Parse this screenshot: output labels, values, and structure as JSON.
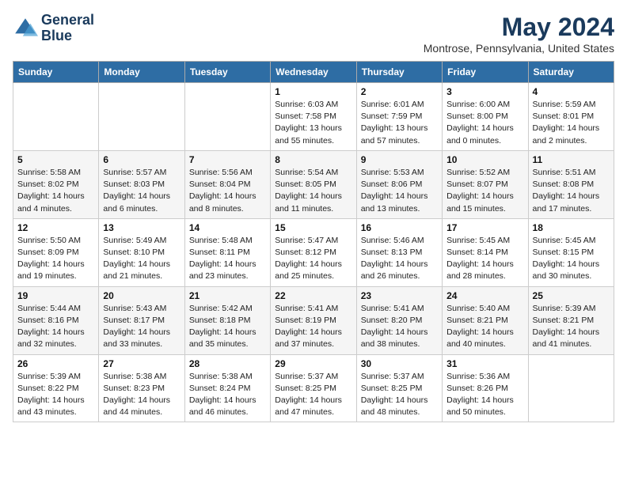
{
  "logo": {
    "line1": "General",
    "line2": "Blue"
  },
  "title": "May 2024",
  "location": "Montrose, Pennsylvania, United States",
  "days_header": [
    "Sunday",
    "Monday",
    "Tuesday",
    "Wednesday",
    "Thursday",
    "Friday",
    "Saturday"
  ],
  "weeks": [
    [
      {
        "day": "",
        "info": ""
      },
      {
        "day": "",
        "info": ""
      },
      {
        "day": "",
        "info": ""
      },
      {
        "day": "1",
        "info": "Sunrise: 6:03 AM\nSunset: 7:58 PM\nDaylight: 13 hours\nand 55 minutes."
      },
      {
        "day": "2",
        "info": "Sunrise: 6:01 AM\nSunset: 7:59 PM\nDaylight: 13 hours\nand 57 minutes."
      },
      {
        "day": "3",
        "info": "Sunrise: 6:00 AM\nSunset: 8:00 PM\nDaylight: 14 hours\nand 0 minutes."
      },
      {
        "day": "4",
        "info": "Sunrise: 5:59 AM\nSunset: 8:01 PM\nDaylight: 14 hours\nand 2 minutes."
      }
    ],
    [
      {
        "day": "5",
        "info": "Sunrise: 5:58 AM\nSunset: 8:02 PM\nDaylight: 14 hours\nand 4 minutes."
      },
      {
        "day": "6",
        "info": "Sunrise: 5:57 AM\nSunset: 8:03 PM\nDaylight: 14 hours\nand 6 minutes."
      },
      {
        "day": "7",
        "info": "Sunrise: 5:56 AM\nSunset: 8:04 PM\nDaylight: 14 hours\nand 8 minutes."
      },
      {
        "day": "8",
        "info": "Sunrise: 5:54 AM\nSunset: 8:05 PM\nDaylight: 14 hours\nand 11 minutes."
      },
      {
        "day": "9",
        "info": "Sunrise: 5:53 AM\nSunset: 8:06 PM\nDaylight: 14 hours\nand 13 minutes."
      },
      {
        "day": "10",
        "info": "Sunrise: 5:52 AM\nSunset: 8:07 PM\nDaylight: 14 hours\nand 15 minutes."
      },
      {
        "day": "11",
        "info": "Sunrise: 5:51 AM\nSunset: 8:08 PM\nDaylight: 14 hours\nand 17 minutes."
      }
    ],
    [
      {
        "day": "12",
        "info": "Sunrise: 5:50 AM\nSunset: 8:09 PM\nDaylight: 14 hours\nand 19 minutes."
      },
      {
        "day": "13",
        "info": "Sunrise: 5:49 AM\nSunset: 8:10 PM\nDaylight: 14 hours\nand 21 minutes."
      },
      {
        "day": "14",
        "info": "Sunrise: 5:48 AM\nSunset: 8:11 PM\nDaylight: 14 hours\nand 23 minutes."
      },
      {
        "day": "15",
        "info": "Sunrise: 5:47 AM\nSunset: 8:12 PM\nDaylight: 14 hours\nand 25 minutes."
      },
      {
        "day": "16",
        "info": "Sunrise: 5:46 AM\nSunset: 8:13 PM\nDaylight: 14 hours\nand 26 minutes."
      },
      {
        "day": "17",
        "info": "Sunrise: 5:45 AM\nSunset: 8:14 PM\nDaylight: 14 hours\nand 28 minutes."
      },
      {
        "day": "18",
        "info": "Sunrise: 5:45 AM\nSunset: 8:15 PM\nDaylight: 14 hours\nand 30 minutes."
      }
    ],
    [
      {
        "day": "19",
        "info": "Sunrise: 5:44 AM\nSunset: 8:16 PM\nDaylight: 14 hours\nand 32 minutes."
      },
      {
        "day": "20",
        "info": "Sunrise: 5:43 AM\nSunset: 8:17 PM\nDaylight: 14 hours\nand 33 minutes."
      },
      {
        "day": "21",
        "info": "Sunrise: 5:42 AM\nSunset: 8:18 PM\nDaylight: 14 hours\nand 35 minutes."
      },
      {
        "day": "22",
        "info": "Sunrise: 5:41 AM\nSunset: 8:19 PM\nDaylight: 14 hours\nand 37 minutes."
      },
      {
        "day": "23",
        "info": "Sunrise: 5:41 AM\nSunset: 8:20 PM\nDaylight: 14 hours\nand 38 minutes."
      },
      {
        "day": "24",
        "info": "Sunrise: 5:40 AM\nSunset: 8:21 PM\nDaylight: 14 hours\nand 40 minutes."
      },
      {
        "day": "25",
        "info": "Sunrise: 5:39 AM\nSunset: 8:21 PM\nDaylight: 14 hours\nand 41 minutes."
      }
    ],
    [
      {
        "day": "26",
        "info": "Sunrise: 5:39 AM\nSunset: 8:22 PM\nDaylight: 14 hours\nand 43 minutes."
      },
      {
        "day": "27",
        "info": "Sunrise: 5:38 AM\nSunset: 8:23 PM\nDaylight: 14 hours\nand 44 minutes."
      },
      {
        "day": "28",
        "info": "Sunrise: 5:38 AM\nSunset: 8:24 PM\nDaylight: 14 hours\nand 46 minutes."
      },
      {
        "day": "29",
        "info": "Sunrise: 5:37 AM\nSunset: 8:25 PM\nDaylight: 14 hours\nand 47 minutes."
      },
      {
        "day": "30",
        "info": "Sunrise: 5:37 AM\nSunset: 8:25 PM\nDaylight: 14 hours\nand 48 minutes."
      },
      {
        "day": "31",
        "info": "Sunrise: 5:36 AM\nSunset: 8:26 PM\nDaylight: 14 hours\nand 50 minutes."
      },
      {
        "day": "",
        "info": ""
      }
    ]
  ]
}
